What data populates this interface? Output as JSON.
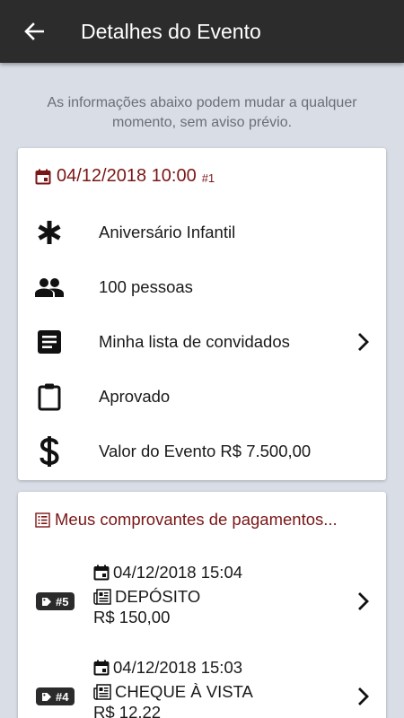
{
  "appbar": {
    "title": "Detalhes do Evento",
    "back_icon": "arrow-back-icon"
  },
  "notice": "As informações abaixo podem mudar a qualquer momento, sem aviso prévio.",
  "event": {
    "date": "04/12/2018 10:00",
    "number": "#1",
    "type": "Aniversário Infantil",
    "guests": "100 pessoas",
    "guest_list": "Minha lista de convidados",
    "status": "Aprovado",
    "value": "Valor do Evento R$ 7.500,00"
  },
  "payments": {
    "title": "Meus comprovantes de pagamentos...",
    "items": [
      {
        "badge": "#5",
        "datetime": "04/12/2018 15:04",
        "method": "DEPÓSITO",
        "amount": "R$ 150,00"
      },
      {
        "badge": "#4",
        "datetime": "04/12/2018 15:03",
        "method": "CHEQUE À VISTA",
        "amount": "R$ 12,22"
      }
    ]
  },
  "colors": {
    "appbar": "#2c2c2c",
    "accent": "#7a1616",
    "background": "#d8dde6"
  }
}
